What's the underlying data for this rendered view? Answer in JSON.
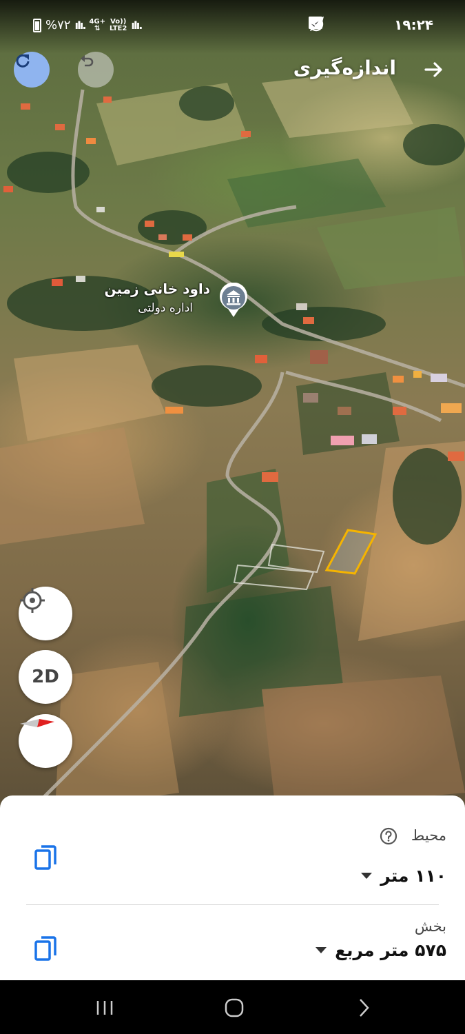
{
  "status_bar": {
    "battery": "%۷۲",
    "network_1": "4G+",
    "network_1_sub": "LTE2",
    "network_2": "Vo))",
    "signal": "ıIı.",
    "time": "۱۹:۲۴",
    "icons": [
      "gallery-icon",
      "check-icon",
      "telegram-icon",
      "whatsapp-icon"
    ]
  },
  "header": {
    "title": "اندازه‌گیری",
    "back_icon": "arrow-right-icon",
    "redo_icon": "redo-icon",
    "undo_icon": "undo-icon"
  },
  "map": {
    "place_name": "داود خانی زمین",
    "place_category": "اداره دولتی",
    "place_icon": "government-building-icon",
    "measured_shape_color": "#f5b400"
  },
  "controls": {
    "locate_icon": "my-location-icon",
    "mode_label": "2D",
    "compass_icon": "compass-icon"
  },
  "measurement": {
    "perimeter_label": "محیط",
    "perimeter_value": "۱۱۰ متر",
    "area_label": "بخش",
    "area_value": "۵۷۵ متر مربع"
  },
  "colors": {
    "accent_blue": "#1a73e8",
    "redo_bg": "#8fb4ef"
  }
}
